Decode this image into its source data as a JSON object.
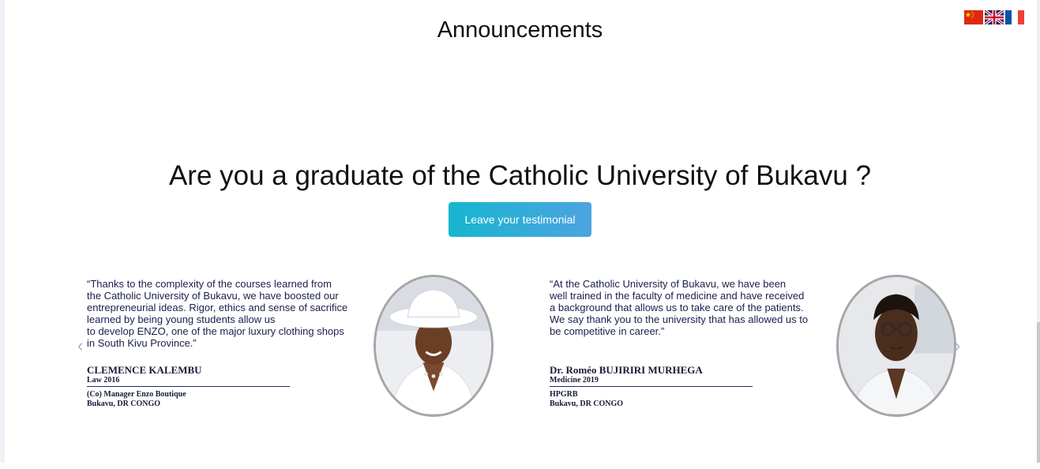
{
  "header": {
    "title": "Announcements",
    "languages": [
      "Chinese",
      "English",
      "French"
    ]
  },
  "cta_section": {
    "question": "Are you a graduate of the Catholic University of Bukavu ?",
    "button_label": "Leave your testimonial"
  },
  "testimonials": [
    {
      "quote": "“Thanks to the complexity of the courses learned from\nthe Catholic University of Bukavu, we have boosted our\nentrepreneurial  ideas. Rigor, ethics and sense of sacrifice\nlearned by being young students allow us\nto develop ENZO, one of the major luxury clothing shops\nin South Kivu Province.”",
      "name": "CLEMENCE KALEMBU",
      "degree": "Law 2016",
      "position": "(Co) Manager Enzo Boutique",
      "location": "Bukavu, DR CONGO"
    },
    {
      "quote": "“At the Catholic University of Bukavu, we have been\nwell trained in the faculty of medicine and have received\na background that allows us to take care of the patients.\nWe say thank you to the university that has allowed us to\nbe competitive in career.”",
      "name": "Dr. Roméo BUJIRIRI MURHEGA",
      "degree": "Medicine 2019",
      "position": "HPGRB",
      "location": "Bukavu, DR CONGO"
    }
  ],
  "carousel": {
    "prev": "‹",
    "next": "›"
  },
  "colors": {
    "button_start": "#16b6cf",
    "button_end": "#4da3e0",
    "text_navy": "#1a1f4d"
  }
}
